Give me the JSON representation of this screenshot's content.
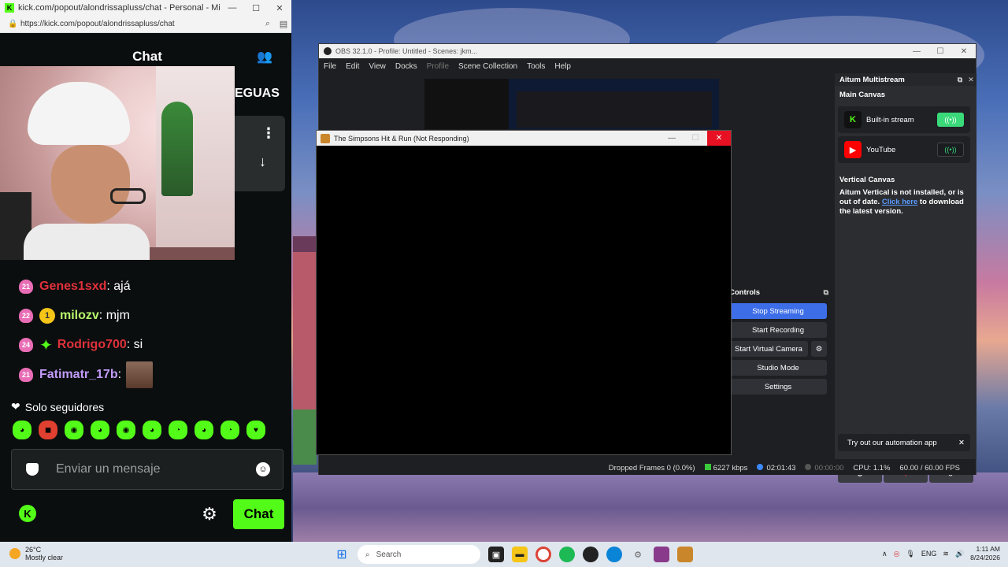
{
  "browser": {
    "title": "kick.com/popout/alondrissapluss/chat - Personal - Microsoft...",
    "url": "https://kick.com/popout/alondrissapluss/chat"
  },
  "chat": {
    "title": "Chat",
    "banner_text": "EGUAS",
    "messages": [
      {
        "badge": "21",
        "username": "Genes1sxd",
        "text": ": ajá",
        "color": "#e0313b",
        "extra": "none"
      },
      {
        "badge": "22",
        "username": "milozv",
        "text": ": mjm",
        "color": "#b9f86d",
        "extra": "gold",
        "extra_label": "1"
      },
      {
        "badge": "24",
        "username": "Rodrigo700",
        "text": ": si",
        "color": "#e0313b",
        "extra": "spark"
      },
      {
        "badge": "21",
        "username": "Fatimatr_17b",
        "text": ":",
        "color": "#c19bf7",
        "extra": "none",
        "emote": true
      }
    ],
    "followers_only": "Solo seguidores",
    "input_placeholder": "Enviar un mensaje",
    "send_label": "Chat",
    "colors": {
      "accent": "#53fc18",
      "background": "#0b0e0f"
    }
  },
  "obs": {
    "title": "OBS 32.1.0 - Profile: Untitled - Scenes: jkm...",
    "menu": [
      "File",
      "Edit",
      "View",
      "Docks",
      "Profile",
      "Scene Collection",
      "Tools",
      "Help"
    ],
    "controls_title": "Controls",
    "controls": [
      "Stop Streaming",
      "Start Recording",
      "Start Virtual Camera",
      "Studio Mode",
      "Settings"
    ],
    "status": {
      "dropped": "Dropped Frames 0 (0.0%)",
      "bitrate": "6227 kbps",
      "stream_time": "02:01:43",
      "rec_time": "00:00:00",
      "cpu": "CPU: 1.1%",
      "fps": "60.00 / 60.00 FPS"
    },
    "multistream": {
      "title": "Aitum Multistream",
      "main_canvas": "Main Canvas",
      "targets": [
        {
          "name": "Built-in stream",
          "icon": "kick-icon",
          "active": true
        },
        {
          "name": "YouTube",
          "icon": "youtube-icon",
          "active": false
        }
      ],
      "vertical_canvas": "Vertical Canvas",
      "vertical_msg": "Aitum Vertical is not installed, or is out of date.",
      "link_text": "Click here",
      "link_rest": "to download the latest version.",
      "try_text": "Try out our automation app"
    }
  },
  "game": {
    "title": "The Simpsons Hit & Run (Not Responding)"
  },
  "taskbar": {
    "temp": "26°C",
    "weather": "Mostly clear",
    "search": "Search",
    "lang": "ENG",
    "time": "1:11 AM",
    "date": "8/24/2026"
  }
}
